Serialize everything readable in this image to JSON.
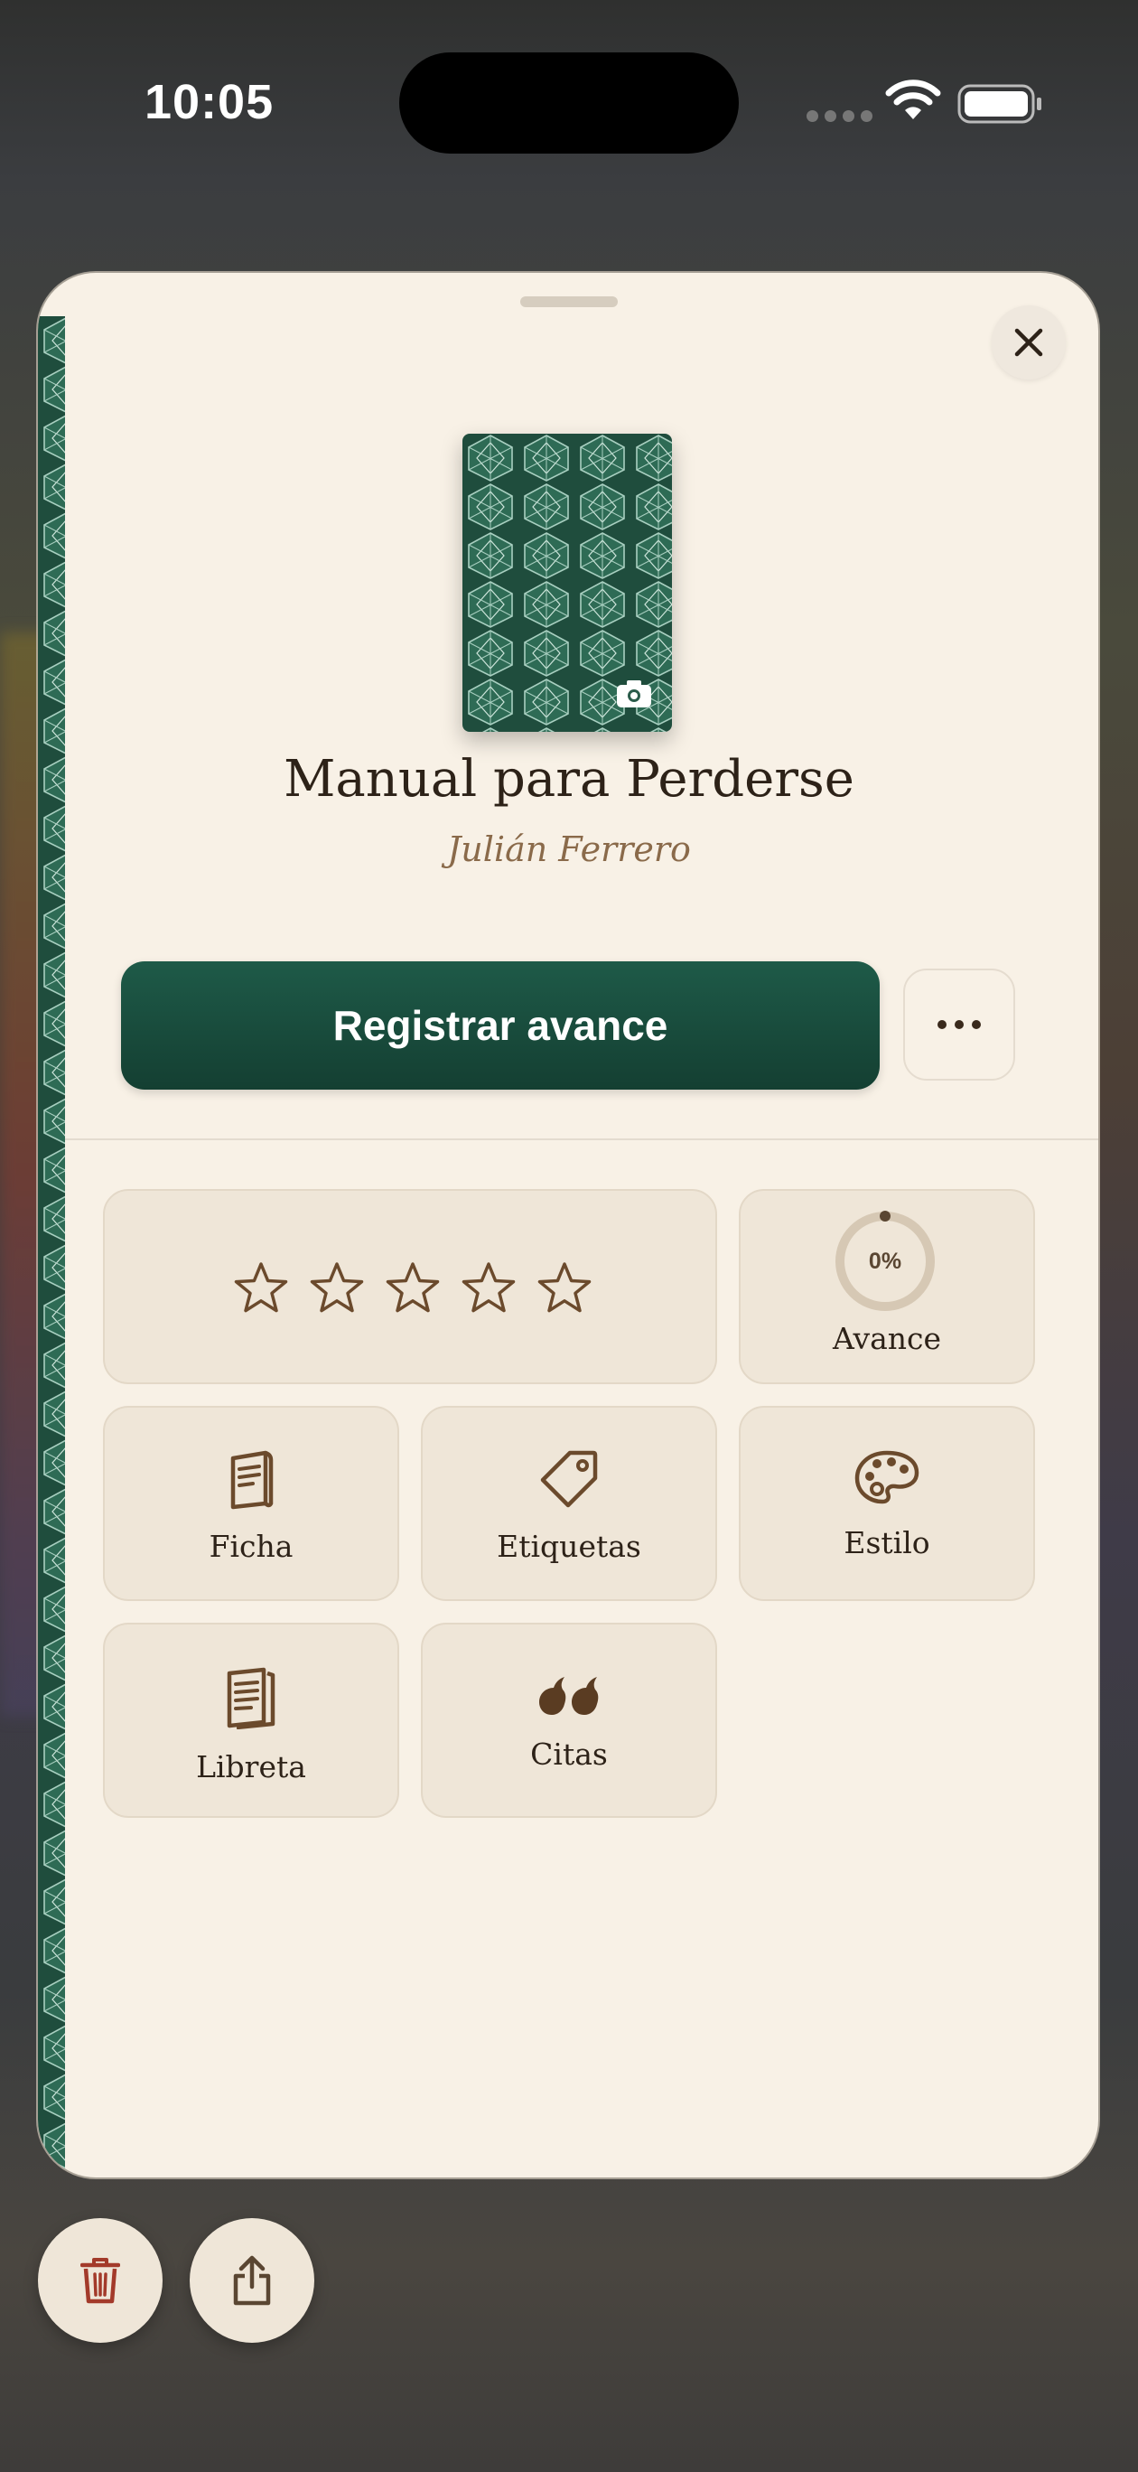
{
  "status_bar": {
    "time": "10:05"
  },
  "book": {
    "title": "Manual para Perderse",
    "author": "Julián Ferrero"
  },
  "actions": {
    "primary_label": "Registrar avance",
    "more_icon": "ellipsis-icon"
  },
  "rating": {
    "stars_filled": 0,
    "stars_total": 5
  },
  "progress": {
    "percent_label": "0%",
    "fraction": 0,
    "label": "Avance"
  },
  "tiles": [
    {
      "label": "Ficha",
      "icon": "document-icon"
    },
    {
      "label": "Etiquetas",
      "icon": "tag-icon"
    },
    {
      "label": "Estilo",
      "icon": "palette-icon"
    },
    {
      "label": "Libreta",
      "icon": "notebook-icon"
    },
    {
      "label": "Citas",
      "icon": "quote-icon"
    }
  ],
  "colors": {
    "accent": "#1e5a48",
    "sheet": "#f8f1e6",
    "tile": "#efe6d8",
    "icon_brown": "#6b4a2c",
    "delete_red": "#a33a2a"
  }
}
